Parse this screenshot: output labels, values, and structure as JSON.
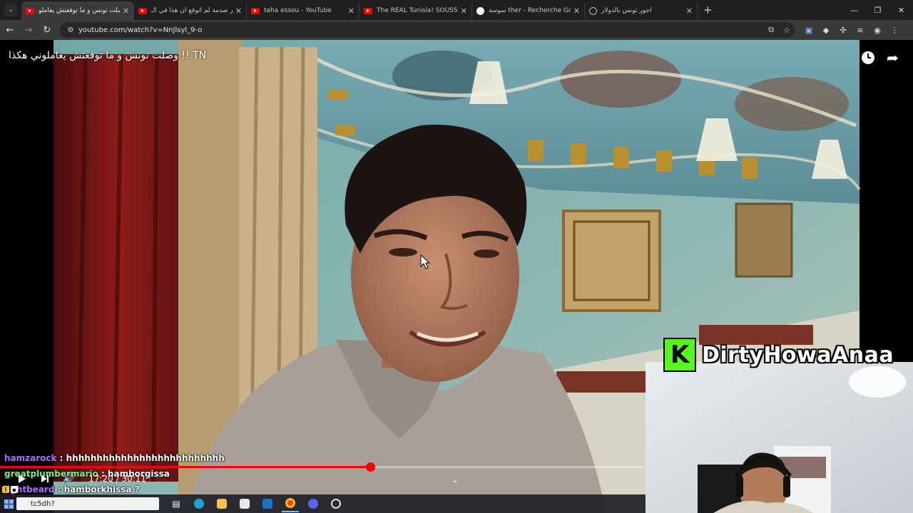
{
  "browser": {
    "tabs": [
      {
        "title": "وصلت تونس و ما توقعتش يعاملو",
        "favicon": "youtube-icon",
        "active": true
      },
      {
        "title": "أكبر صدمة لم أتوقع أن هذا في الـ",
        "favicon": "youtube-icon",
        "active": false
      },
      {
        "title": "taha essou - YouTube",
        "favicon": "youtube-icon",
        "active": false
      },
      {
        "title": "The REAL Tunisia! SOUSSE, Wh",
        "favicon": "youtube-icon",
        "active": false
      },
      {
        "title": "سوسة ther - Recherche Google",
        "favicon": "google-icon",
        "active": false
      },
      {
        "title": "أجور تونس بالدولار",
        "favicon": "globe-icon",
        "active": false
      }
    ],
    "url": "youtube.com/watch?v=NnJlsyl_9-o"
  },
  "video": {
    "title": "وصلت تونس و ما توقعتش يعاملوني هكذا !! TN",
    "progress_fraction": 0.573,
    "time_display": "17:20 / 30:11"
  },
  "chat": [
    {
      "user": "hamzarock",
      "user_color": "#b06bff",
      "sep": " : ",
      "message": "hhhhhhhhhhhhhhhhhhhhhhhhhh"
    },
    {
      "user": "greatplumbermario",
      "user_color": "#7cf07c",
      "sep": " : ",
      "message": "hamborgissa"
    },
    {
      "user": "lightbeard",
      "user_color": "#b06bff",
      "sep": " : ",
      "message": "hamborkhissa ?"
    }
  ],
  "streamer": {
    "logo_letter": "K",
    "name": "DirtyHowaAnaa"
  },
  "taskbar": {
    "search_text": "tc5dh?"
  },
  "colors": {
    "chrome_bg": "#1f1f1f",
    "toolbar_bg": "#3a3a3a",
    "progress_red": "#ff0000",
    "kick_green": "#53fc18"
  }
}
